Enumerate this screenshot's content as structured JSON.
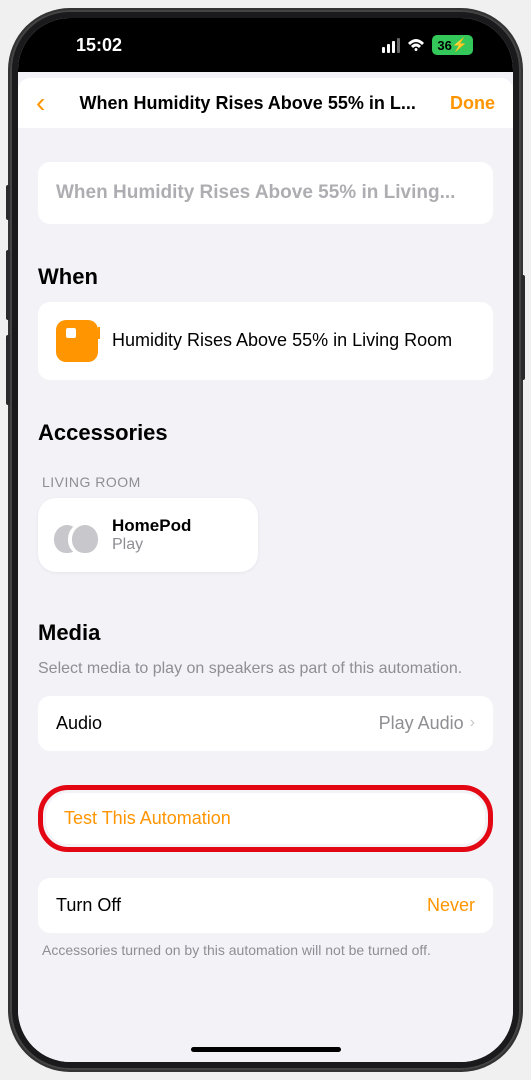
{
  "status_bar": {
    "time": "15:02",
    "battery_percent": "36",
    "battery_charging_glyph": "⚡"
  },
  "nav": {
    "title": "When Humidity Rises Above 55% in L...",
    "done_label": "Done"
  },
  "automation_name_placeholder": "When Humidity Rises Above 55% in Living...",
  "sections": {
    "when": {
      "title": "When",
      "trigger": "Humidity Rises Above 55% in Living Room"
    },
    "accessories": {
      "title": "Accessories",
      "room_label": "LIVING ROOM",
      "items": [
        {
          "name": "HomePod",
          "status": "Play"
        }
      ]
    },
    "media": {
      "title": "Media",
      "subtitle": "Select media to play on speakers as part of this automation.",
      "row_label": "Audio",
      "row_value": "Play Audio"
    },
    "test": {
      "label": "Test This Automation"
    },
    "turnoff": {
      "label": "Turn Off",
      "value": "Never",
      "footer": "Accessories turned on by this automation will not be turned off."
    }
  }
}
